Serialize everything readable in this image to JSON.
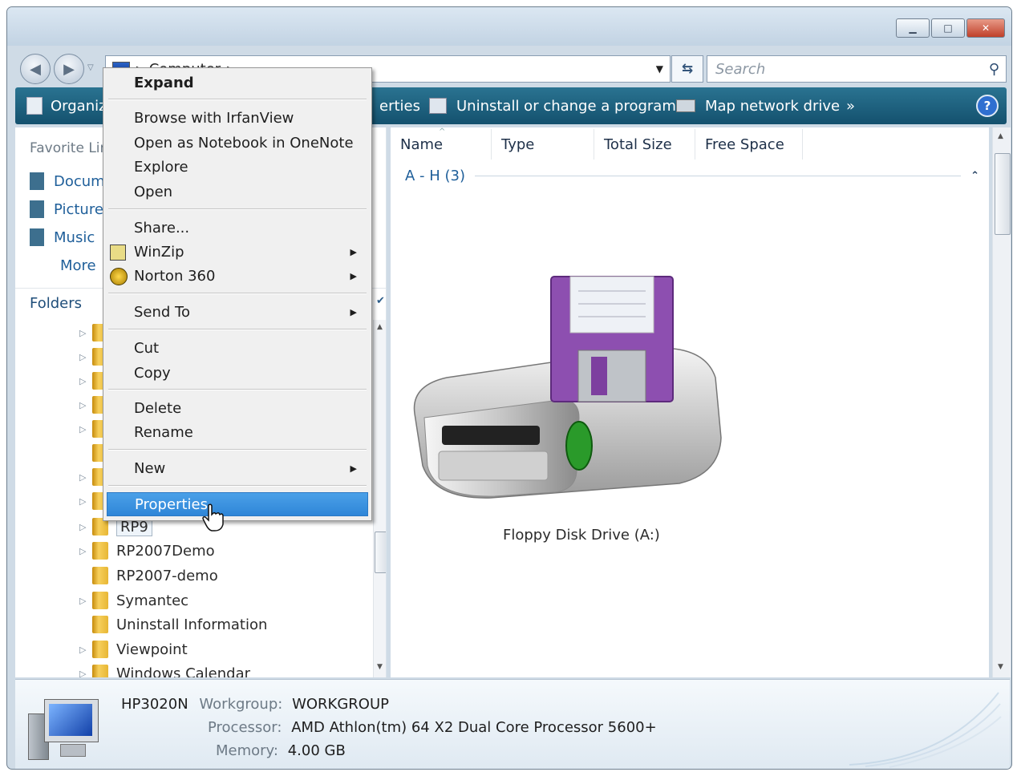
{
  "address": {
    "crumb": "Computer",
    "search_placeholder": "Search"
  },
  "toolbar": {
    "organize": "Organize",
    "properties_partial": "erties",
    "uninstall": "Uninstall or change a program",
    "map_drive": "Map network drive",
    "more": "»",
    "help": "?"
  },
  "nav": {
    "favorite_links": "Favorite Lin",
    "links": [
      "Docum",
      "Picture",
      "Music"
    ],
    "more": "More",
    "folders": "Folders",
    "tree": [
      "RP9",
      "RP2007Demo",
      "RP2007-demo",
      "Symantec",
      "Uninstall Information",
      "Viewpoint",
      "Windows Calendar"
    ]
  },
  "columns": [
    "Name",
    "Type",
    "Total Size",
    "Free Space"
  ],
  "group": {
    "label": "A - H (3)"
  },
  "drive": {
    "label": "Floppy Disk Drive (A:)"
  },
  "details": {
    "computer_name": "HP3020N",
    "workgroup_label": "Workgroup:",
    "workgroup_value": "WORKGROUP",
    "processor_label": "Processor:",
    "processor_value": "AMD Athlon(tm) 64 X2 Dual Core Processor 5600+",
    "memory_label": "Memory:",
    "memory_value": "4.00 GB"
  },
  "context_menu": {
    "expand": "Expand",
    "browse_irfan": "Browse with IrfanView",
    "open_onenote": "Open as Notebook in OneNote",
    "explore": "Explore",
    "open": "Open",
    "share": "Share...",
    "winzip": "WinZip",
    "norton": "Norton 360",
    "send_to": "Send To",
    "cut": "Cut",
    "copy": "Copy",
    "delete": "Delete",
    "rename": "Rename",
    "new": "New",
    "properties": "Properties"
  },
  "colors": {
    "toolbar": "#1d6383",
    "highlight": "#3b93e0",
    "floppy": "#8d4fb0"
  }
}
